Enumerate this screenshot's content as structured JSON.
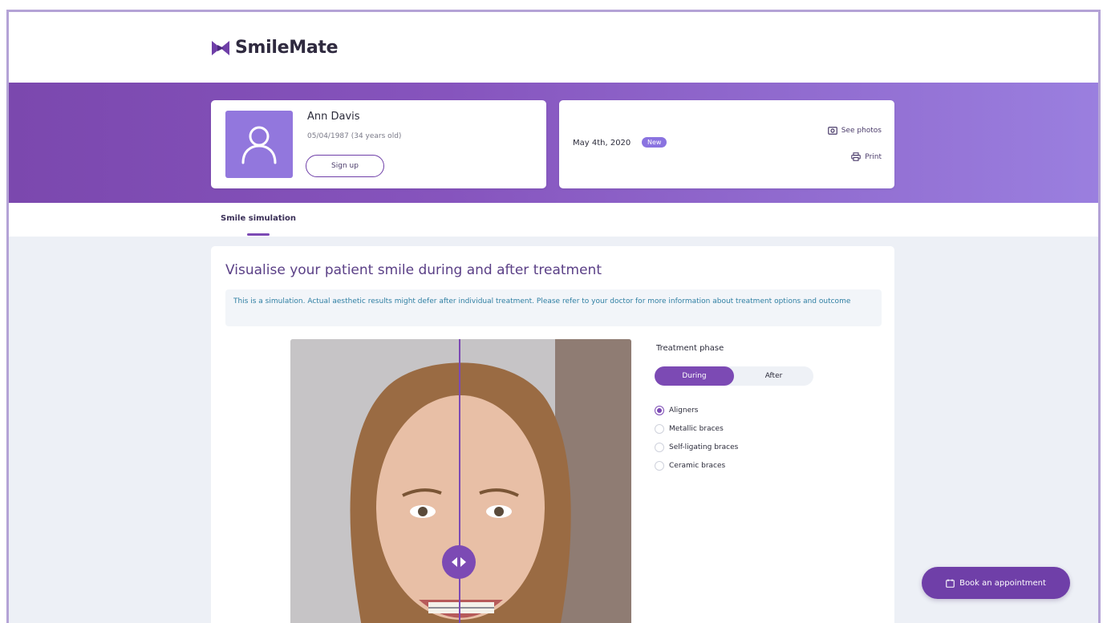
{
  "brand": {
    "name": "SmileMate",
    "logo_icon": "bowtie-play-icon",
    "accent": "#7c4ab4"
  },
  "patient": {
    "name": "Ann Davis",
    "dob": "05/04/1987 (34 years old)",
    "signup_label": "Sign up",
    "avatar_icon": "user-icon"
  },
  "visit": {
    "date": "May 4th, 2020",
    "badge": "New",
    "see_photos_label": "See photos",
    "print_label": "Print"
  },
  "tabs": [
    {
      "label": "Smile simulation",
      "active": true
    }
  ],
  "main": {
    "title": "Visualise your patient smile during and after treatment",
    "notice": "This is a simulation. Actual aesthetic results might defer after individual treatment. Please refer to your doctor for more information about treatment options and outcome"
  },
  "treatment": {
    "label": "Treatment phase",
    "phases": [
      "During",
      "After"
    ],
    "active_phase": "During",
    "options": [
      "Aligners",
      "Metallic braces",
      "Self-ligating braces",
      "Ceramic braces"
    ],
    "selected_option": "Aligners"
  },
  "cta": {
    "book_label": "Book an appointment",
    "icon": "calendar-icon"
  }
}
